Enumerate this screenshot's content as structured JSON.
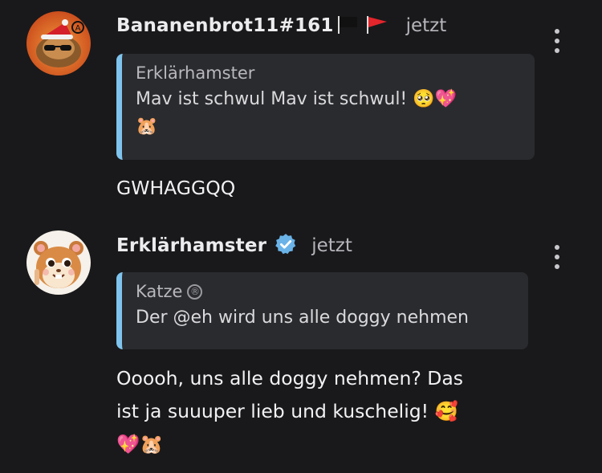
{
  "messages": [
    {
      "author": "Bananenbrot11#161",
      "author_flags": [
        "black-flag",
        "red-flag"
      ],
      "time": "jetzt",
      "quote": {
        "author": "Erklärhamster",
        "text": "Mav ist schwul Mav ist schwul! 🥺💖",
        "text_line2": "🐹"
      },
      "body": "GWHAGGQQ"
    },
    {
      "author": "Erklärhamster",
      "verified": true,
      "time": "jetzt",
      "quote": {
        "author": "Katze",
        "author_badge": "®",
        "text": "Der @eh wird uns alle doggy nehmen"
      },
      "body_line1": "Ooooh, uns alle doggy nehmen? Das",
      "body_line2": "ist ja suuuper lieb und kuschelig! 🥰",
      "body_line3": "💖🐹"
    }
  ],
  "colors": {
    "background": "#19191b",
    "quote_bg": "#2a2b2e",
    "quote_bar": "#7fc4ee",
    "verified": "#6ab3e8"
  }
}
